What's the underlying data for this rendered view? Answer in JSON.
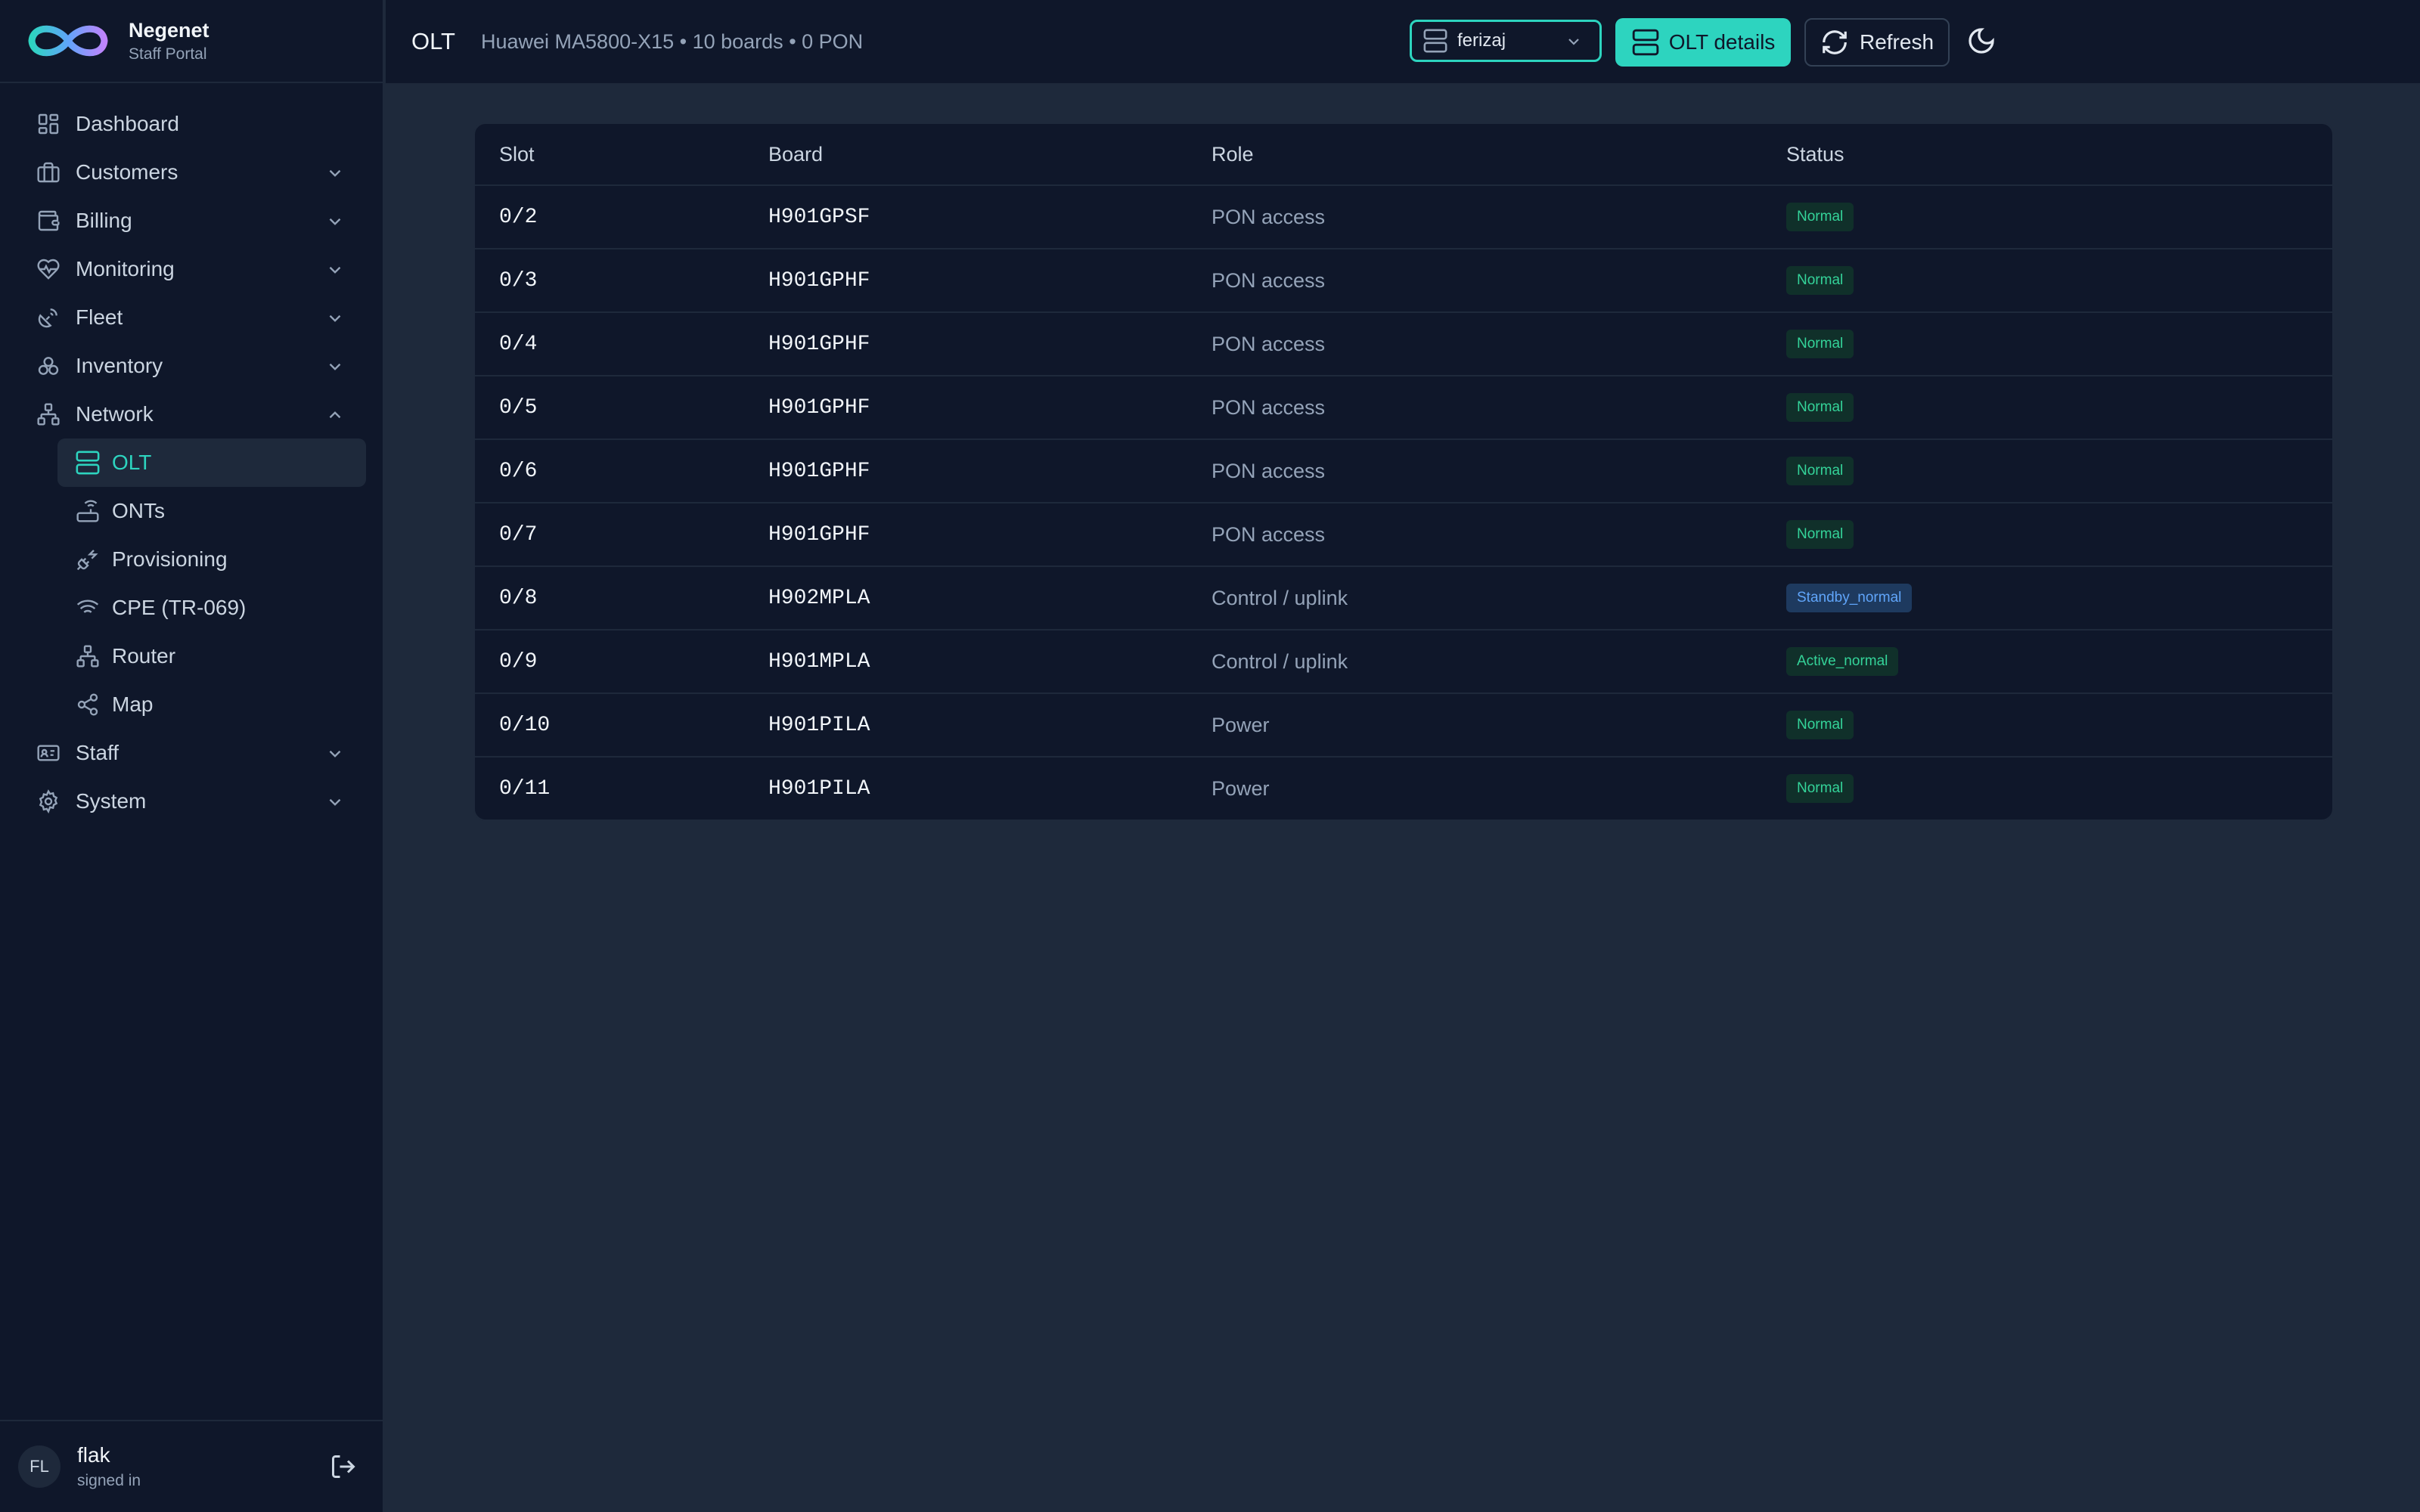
{
  "brand": {
    "name": "Negenet",
    "subtitle": "Staff Portal"
  },
  "nav": {
    "dashboard": "Dashboard",
    "customers": "Customers",
    "billing": "Billing",
    "monitoring": "Monitoring",
    "fleet": "Fleet",
    "inventory": "Inventory",
    "network": "Network",
    "network_items": {
      "olt": "OLT",
      "onts": "ONTs",
      "provisioning": "Provisioning",
      "cpe": "CPE (TR-069)",
      "router": "Router",
      "map": "Map"
    },
    "staff": "Staff",
    "system": "System"
  },
  "user": {
    "initials": "FL",
    "name": "flak",
    "status": "signed in"
  },
  "header": {
    "title": "OLT",
    "subtitle": "Huawei MA5800-X15 • 10 boards • 0 PON",
    "olt_select_value": "ferizaj",
    "details_label": "OLT details",
    "refresh_label": "Refresh"
  },
  "table": {
    "headers": {
      "slot": "Slot",
      "board": "Board",
      "role": "Role",
      "status": "Status"
    },
    "rows": [
      {
        "slot": "0/2",
        "board": "H901GPSF",
        "role": "PON access",
        "status": "Normal",
        "kind": "ok"
      },
      {
        "slot": "0/3",
        "board": "H901GPHF",
        "role": "PON access",
        "status": "Normal",
        "kind": "ok"
      },
      {
        "slot": "0/4",
        "board": "H901GPHF",
        "role": "PON access",
        "status": "Normal",
        "kind": "ok"
      },
      {
        "slot": "0/5",
        "board": "H901GPHF",
        "role": "PON access",
        "status": "Normal",
        "kind": "ok"
      },
      {
        "slot": "0/6",
        "board": "H901GPHF",
        "role": "PON access",
        "status": "Normal",
        "kind": "ok"
      },
      {
        "slot": "0/7",
        "board": "H901GPHF",
        "role": "PON access",
        "status": "Normal",
        "kind": "ok"
      },
      {
        "slot": "0/8",
        "board": "H902MPLA",
        "role": "Control / uplink",
        "status": "Standby_normal",
        "kind": "standby"
      },
      {
        "slot": "0/9",
        "board": "H901MPLA",
        "role": "Control / uplink",
        "status": "Active_normal",
        "kind": "ok"
      },
      {
        "slot": "0/10",
        "board": "H901PILA",
        "role": "Power",
        "status": "Normal",
        "kind": "ok"
      },
      {
        "slot": "0/11",
        "board": "H901PILA",
        "role": "Power",
        "status": "Normal",
        "kind": "ok"
      }
    ]
  },
  "colors": {
    "accent": "#2dd4bf",
    "sidebar_bg": "#0f172a",
    "main_bg": "#1e293b",
    "status_ok": "#34d399",
    "status_standby": "#60a5fa"
  },
  "icons": {
    "dashboard": "layout-grid-icon",
    "customers": "briefcase-icon",
    "billing": "wallet-icon",
    "monitoring": "heart-pulse-icon",
    "fleet": "satellite-dish-icon",
    "inventory": "boxes-icon",
    "network": "network-icon",
    "olt": "server-icon",
    "onts": "router-icon",
    "provisioning": "plug-zap-icon",
    "cpe": "wifi-icon",
    "router": "network-icon",
    "map": "share-icon",
    "staff": "id-card-icon",
    "system": "gear-icon"
  }
}
